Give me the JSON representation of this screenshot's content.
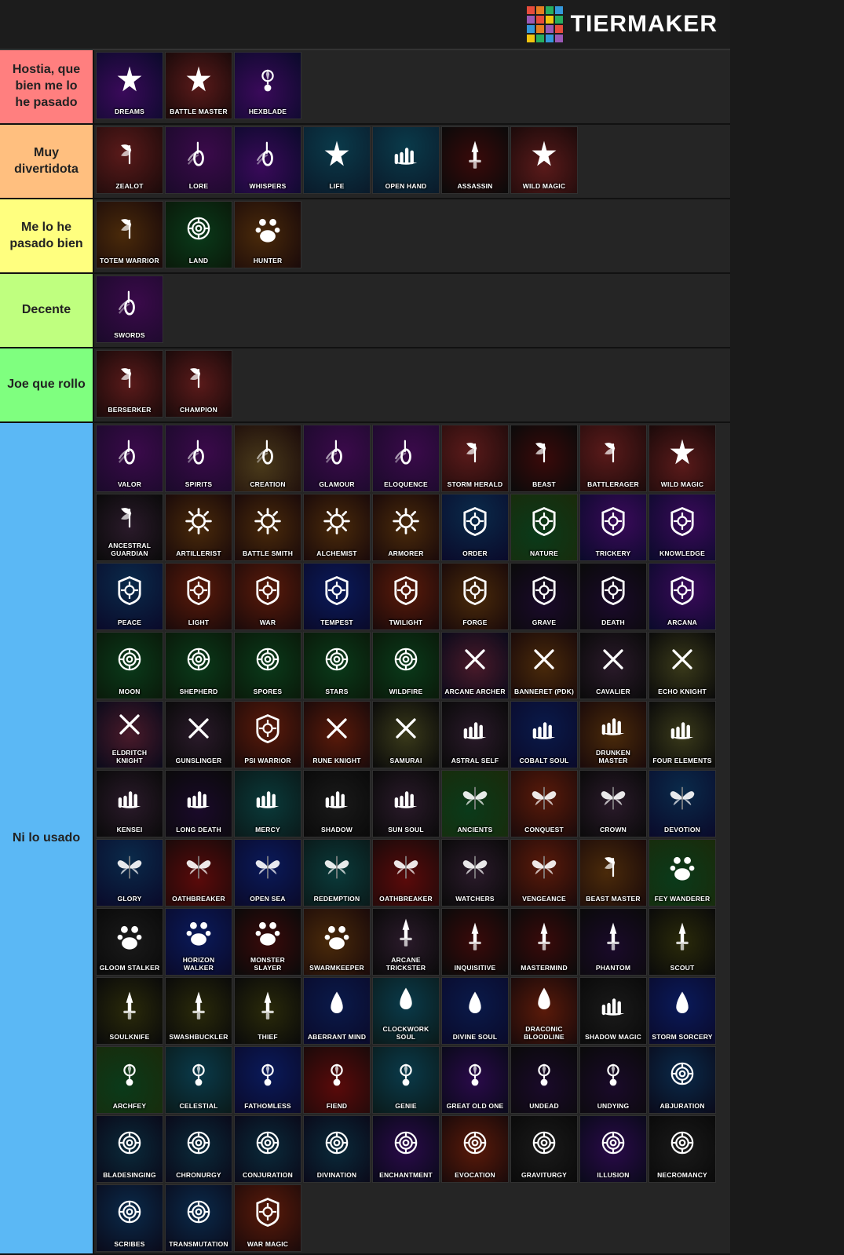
{
  "header": {
    "logo_text": "TiERMAkER"
  },
  "tiers": [
    {
      "id": "s",
      "label": "Hostia, que bien me lo he pasado",
      "label_color": "#ff7f7f",
      "items": [
        {
          "name": "Dreams",
          "icon": "🎭",
          "bg": "bg-dark-red"
        },
        {
          "name": "Battle Master",
          "icon": "⚔",
          "bg": "bg-dark-red"
        },
        {
          "name": "Hexblade",
          "icon": "👁",
          "bg": "bg-dark-purple"
        }
      ]
    },
    {
      "id": "a",
      "label": "Muy divertidota",
      "label_color": "#ffbf7f",
      "items": [
        {
          "name": "Zealot",
          "icon": "🪓",
          "bg": "bg-dark-red"
        },
        {
          "name": "Lore",
          "icon": "🎵",
          "bg": "bg-dark-purple"
        },
        {
          "name": "Whispers",
          "icon": "🏹",
          "bg": "bg-dark-purple"
        },
        {
          "name": "Life",
          "icon": "🤲",
          "bg": "bg-dark-teal"
        },
        {
          "name": "Open Hand",
          "icon": "✋",
          "bg": "bg-dark-teal"
        },
        {
          "name": "Assassin",
          "icon": "✦",
          "bg": "bg-dark-red"
        },
        {
          "name": "Wild Magic",
          "icon": "💧",
          "bg": "bg-dark-red"
        }
      ]
    },
    {
      "id": "b",
      "label": "Me lo he pasado bien",
      "label_color": "#ffff7f",
      "items": [
        {
          "name": "Totem Warrior",
          "icon": "🪓",
          "bg": "bg-dark-red"
        },
        {
          "name": "Land",
          "icon": "🌿",
          "bg": "bg-dark-green"
        },
        {
          "name": "Hunter",
          "icon": "🐾",
          "bg": "bg-dark-green"
        }
      ]
    },
    {
      "id": "c",
      "label": "Decente",
      "label_color": "#bfff7f",
      "items": [
        {
          "name": "Swords",
          "icon": "🎵",
          "bg": "bg-dark-purple"
        }
      ]
    },
    {
      "id": "d",
      "label": "Joe que rollo",
      "label_color": "#7fff7f",
      "items": [
        {
          "name": "Berserker",
          "icon": "🪓",
          "bg": "bg-dark-red"
        },
        {
          "name": "Champion",
          "icon": "⚔",
          "bg": "bg-dark-red"
        }
      ]
    },
    {
      "id": "f",
      "label": "Ni lo usado",
      "label_color": "#5bb8f5",
      "items": [
        {
          "name": "Valor",
          "icon": "🎵",
          "bg": "bg-dark-purple"
        },
        {
          "name": "Spirits",
          "icon": "🎵",
          "bg": "bg-mixed1"
        },
        {
          "name": "Creation",
          "icon": "🎵",
          "bg": "bg-mixed2"
        },
        {
          "name": "Glamour",
          "icon": "🎵",
          "bg": "bg-dark-purple"
        },
        {
          "name": "Eloquence",
          "icon": "🎵",
          "bg": "bg-dark-purple"
        },
        {
          "name": "Storm Herald",
          "icon": "🪓",
          "bg": "bg-dark-red"
        },
        {
          "name": "Beast",
          "icon": "🪓",
          "bg": "bg-dark-red"
        },
        {
          "name": "Battlerager",
          "icon": "🪓",
          "bg": "bg-dark-red"
        },
        {
          "name": "Wild Magic",
          "icon": "🪓",
          "bg": "bg-dark-red"
        },
        {
          "name": "Ancestral Guardian",
          "icon": "🪓",
          "bg": "bg-dark-red"
        },
        {
          "name": "Artillerist",
          "icon": "⚙",
          "bg": "bg-dark-red"
        },
        {
          "name": "Battle Smith",
          "icon": "⚙",
          "bg": "bg-dark-red"
        },
        {
          "name": "Alchemist",
          "icon": "⚙",
          "bg": "bg-orange"
        },
        {
          "name": "Armorer",
          "icon": "⚙",
          "bg": "bg-orange"
        },
        {
          "name": "Order",
          "icon": "☯",
          "bg": "bg-dark-purple"
        },
        {
          "name": "Nature",
          "icon": "☯",
          "bg": "bg-dark-green"
        },
        {
          "name": "Trickery",
          "icon": "☯",
          "bg": "bg-dark-purple"
        },
        {
          "name": "Knowledge",
          "icon": "☯",
          "bg": "bg-dark-purple"
        },
        {
          "name": "Peace",
          "icon": "☯",
          "bg": "bg-dark-teal"
        },
        {
          "name": "Light",
          "icon": "☯",
          "bg": "bg-dark-red"
        },
        {
          "name": "War",
          "icon": "☯",
          "bg": "bg-dark-red"
        },
        {
          "name": "Tempest",
          "icon": "☯",
          "bg": "bg-dark-blue"
        },
        {
          "name": "Twilight",
          "icon": "☯",
          "bg": "bg-mixed3"
        },
        {
          "name": "Forge",
          "icon": "☯",
          "bg": "bg-orange"
        },
        {
          "name": "Grave",
          "icon": "☯",
          "bg": "bg-dark"
        },
        {
          "name": "Death",
          "icon": "☯",
          "bg": "bg-dark"
        },
        {
          "name": "Arcana",
          "icon": "☯",
          "bg": "bg-dark-purple"
        },
        {
          "name": "Moon",
          "icon": "☯",
          "bg": "bg-dark-green"
        },
        {
          "name": "Shepherd",
          "icon": "☯",
          "bg": "bg-dark-green"
        },
        {
          "name": "Spores",
          "icon": "☯",
          "bg": "bg-dark-green"
        },
        {
          "name": "Stars",
          "icon": "🌟",
          "bg": "bg-dark-green"
        },
        {
          "name": "Wildfire",
          "icon": "🌟",
          "bg": "bg-dark-green"
        },
        {
          "name": "Arcane Archer",
          "icon": "⚡",
          "bg": "bg-orange"
        },
        {
          "name": "Banneret (PDK)",
          "icon": "⚡",
          "bg": "bg-dark-red"
        },
        {
          "name": "Cavalier",
          "icon": "⚡",
          "bg": "bg-dark-red"
        },
        {
          "name": "Echo Knight",
          "icon": "⚡",
          "bg": "bg-mixed4"
        },
        {
          "name": "Eldritch Knight",
          "icon": "⚡",
          "bg": "bg-dark-red"
        },
        {
          "name": "Gunslinger",
          "icon": "⚡",
          "bg": "bg-dark"
        },
        {
          "name": "Psi Warrior",
          "icon": "⚡",
          "bg": "bg-dark-blue"
        },
        {
          "name": "Rune Knight",
          "icon": "⚡",
          "bg": "bg-dark-red"
        },
        {
          "name": "Samurai",
          "icon": "🪓",
          "bg": "bg-dark-red"
        },
        {
          "name": "Astral Self",
          "icon": "✋",
          "bg": "bg-dark-teal"
        },
        {
          "name": "Cobalt Soul",
          "icon": "✋",
          "bg": "bg-dark-blue"
        },
        {
          "name": "Drunken Master",
          "icon": "✋",
          "bg": "bg-orange"
        },
        {
          "name": "Four Elements",
          "icon": "✋",
          "bg": "bg-dark-teal"
        },
        {
          "name": "Kensei",
          "icon": "✋",
          "bg": "bg-dark-teal"
        },
        {
          "name": "Long Death",
          "icon": "✋",
          "bg": "bg-dark"
        },
        {
          "name": "Mercy",
          "icon": "✋",
          "bg": "bg-dark-teal"
        },
        {
          "name": "Shadow",
          "icon": "✋",
          "bg": "bg-dark"
        },
        {
          "name": "Sun Soul",
          "icon": "✋",
          "bg": "bg-dark-teal"
        },
        {
          "name": "Ancients",
          "icon": "🦋",
          "bg": "bg-dark-green"
        },
        {
          "name": "Conquest",
          "icon": "🦋",
          "bg": "bg-dark-red"
        },
        {
          "name": "Crown",
          "icon": "🦋",
          "bg": "bg-dark-purple"
        },
        {
          "name": "Devotion",
          "icon": "🦋",
          "bg": "bg-dark-teal"
        },
        {
          "name": "Glory",
          "icon": "🦋",
          "bg": "bg-dark-teal"
        },
        {
          "name": "Oathbreaker",
          "icon": "🦋",
          "bg": "bg-dark"
        },
        {
          "name": "Open Sea",
          "icon": "🦋",
          "bg": "bg-dark-blue"
        },
        {
          "name": "Redemption",
          "icon": "🦋",
          "bg": "bg-dark-teal"
        },
        {
          "name": "Oathbreaker",
          "icon": "🦋",
          "bg": "bg-dark"
        },
        {
          "name": "Watchers",
          "icon": "🦋",
          "bg": "bg-dark-blue"
        },
        {
          "name": "Vengeance",
          "icon": "👿",
          "bg": "bg-dark-red"
        },
        {
          "name": "Beast Master",
          "icon": "✗",
          "bg": "bg-dark-red"
        },
        {
          "name": "Fey Wanderer",
          "icon": "✗",
          "bg": "bg-dark-green"
        },
        {
          "name": "Gloom Stalker",
          "icon": "✗",
          "bg": "bg-dark"
        },
        {
          "name": "Horizon Walker",
          "icon": "✗",
          "bg": "bg-dark-teal"
        },
        {
          "name": "Monster Slayer",
          "icon": "✗",
          "bg": "bg-dark-red"
        },
        {
          "name": "Swarmkeeper",
          "icon": "✗",
          "bg": "bg-dark-green"
        },
        {
          "name": "Arcane Trickster",
          "icon": "✦",
          "bg": "bg-dark-teal"
        },
        {
          "name": "Inquisitive",
          "icon": "✦",
          "bg": "bg-dark-red"
        },
        {
          "name": "Mastermind",
          "icon": "✦",
          "bg": "bg-dark-purple"
        },
        {
          "name": "Phantom",
          "icon": "✦",
          "bg": "bg-dark"
        },
        {
          "name": "Scout",
          "icon": "✦",
          "bg": "bg-dark-green"
        },
        {
          "name": "Soulknife",
          "icon": "✦",
          "bg": "bg-dark-teal"
        },
        {
          "name": "Swashbuckler",
          "icon": "✦",
          "bg": "bg-dark-red"
        },
        {
          "name": "Thief",
          "icon": "✦",
          "bg": "bg-dark"
        },
        {
          "name": "Aberrant Mind",
          "icon": "💧",
          "bg": "bg-dark-red"
        },
        {
          "name": "Clockwork Soul",
          "icon": "💧",
          "bg": "bg-dark-teal"
        },
        {
          "name": "Divine Soul",
          "icon": "💧",
          "bg": "bg-dark-blue"
        },
        {
          "name": "Draconic Bloodline",
          "icon": "💧",
          "bg": "bg-dark-red"
        },
        {
          "name": "Shadow Magic",
          "icon": "💧",
          "bg": "bg-dark"
        },
        {
          "name": "Storm Sorcery",
          "icon": "💧",
          "bg": "bg-dark-blue"
        },
        {
          "name": "Archfey",
          "icon": "👁",
          "bg": "bg-mixed5"
        },
        {
          "name": "Celestial",
          "icon": "👁",
          "bg": "bg-dark-blue"
        },
        {
          "name": "Fathomless",
          "icon": "👁",
          "bg": "bg-dark-blue"
        },
        {
          "name": "Fiend",
          "icon": "👁",
          "bg": "bg-dark-red"
        },
        {
          "name": "Genie",
          "icon": "👁",
          "bg": "bg-dark-teal"
        },
        {
          "name": "Great Old One",
          "icon": "👁",
          "bg": "bg-dark-purple"
        },
        {
          "name": "Undead",
          "icon": "👁",
          "bg": "bg-dark"
        },
        {
          "name": "Undying",
          "icon": "👁",
          "bg": "bg-dark"
        },
        {
          "name": "Abjuration",
          "icon": "🌀",
          "bg": "bg-dark-blue"
        },
        {
          "name": "Bladesinging",
          "icon": "🌀",
          "bg": "bg-dark-green"
        },
        {
          "name": "Chronurgy",
          "icon": "🌀",
          "bg": "bg-dark-teal"
        },
        {
          "name": "Conjuration",
          "icon": "🌀",
          "bg": "bg-dark-purple"
        },
        {
          "name": "Divination",
          "icon": "🌀",
          "bg": "bg-dark-purple"
        },
        {
          "name": "Enchantment",
          "icon": "🌀",
          "bg": "bg-dark-purple"
        },
        {
          "name": "Evocation",
          "icon": "🌀",
          "bg": "bg-dark-red"
        },
        {
          "name": "Graviturgy",
          "icon": "🌀",
          "bg": "bg-dark"
        },
        {
          "name": "Illusion",
          "icon": "🌀",
          "bg": "bg-dark-purple"
        },
        {
          "name": "Necromancy",
          "icon": "🌀",
          "bg": "bg-dark"
        },
        {
          "name": "Scribes",
          "icon": "🌀",
          "bg": "bg-dark-teal"
        },
        {
          "name": "Transmutation",
          "icon": "🌀",
          "bg": "bg-dark-green"
        },
        {
          "name": "War Magic",
          "icon": "🌀",
          "bg": "bg-dark-red"
        }
      ]
    }
  ]
}
